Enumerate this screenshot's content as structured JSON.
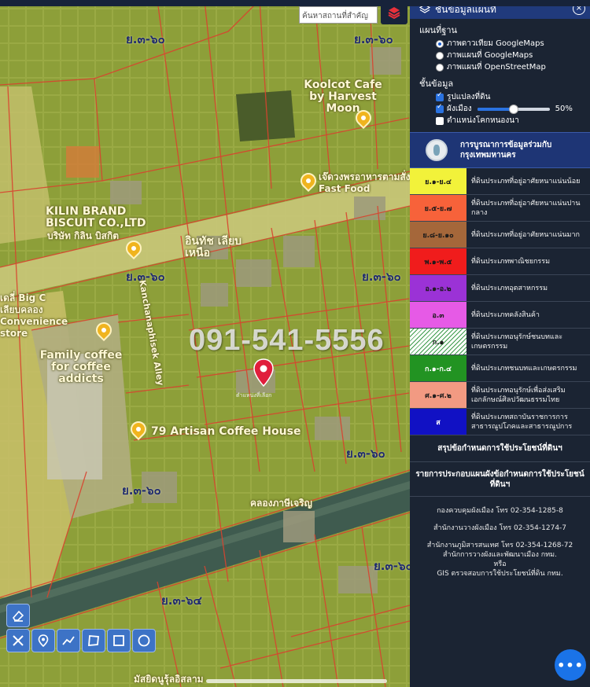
{
  "map": {
    "search_placeholder": "ค้นหาสถานที่สำคัญ",
    "phone_watermark": "091-541-5556",
    "zone_labels": [
      {
        "text": "ย.๓-๖๐"
      },
      {
        "text": "ย.๓-๖๐"
      },
      {
        "text": "ย.๓-๖๐"
      },
      {
        "text": "ย.๓-๖๐"
      },
      {
        "text": "ย.๓-๖๐"
      },
      {
        "text": "ย.๓-๖๐"
      },
      {
        "text": "ย.๓-๖๐"
      },
      {
        "text": "ย.๓-๖๔"
      },
      {
        "text": "ย.๓-๖๐"
      }
    ],
    "pois": [
      {
        "text": "Koolcot Cafe by Harvest Moon"
      },
      {
        "text": "เจ๊ดวงพรอาหารตามสั่ง Fast Food"
      },
      {
        "text": "KILIN BRAND BISCUIT CO.,LTD"
      },
      {
        "text": "บริษัท กิลิน บิสกิต"
      },
      {
        "text": "อินทัช เลียบเหนือ"
      },
      {
        "text": "Kanchanaphisek Alley"
      },
      {
        "text": "Family coffee for coffee addicts"
      },
      {
        "text": "79 Artisan Coffee House"
      },
      {
        "text": "เดลี่ Big C เลียบคลอง Convenience store"
      },
      {
        "text": "คลองภาษีเจริญ"
      },
      {
        "text": "มัสยิดนูรุ้ลอิสลาม"
      }
    ],
    "marker_label": "ตำแหน่งที่เลือก",
    "tools": [
      "eraser-icon",
      "clear-icon",
      "pin-icon",
      "polyline-icon",
      "polygon-icon",
      "rectangle-icon",
      "circle-icon"
    ]
  },
  "panel": {
    "header": "ชั้นข้อมูลแผนที่",
    "close": "×",
    "basemap_title": "แผนที่ฐาน",
    "basemaps": [
      {
        "label": "ภาพดาวเทียม GoogleMaps",
        "selected": true
      },
      {
        "label": "ภาพแผนที่ GoogleMaps",
        "selected": false
      },
      {
        "label": "ภาพแผนที่ OpenStreetMap",
        "selected": false
      }
    ],
    "layers_title": "ชั้นข้อมูล",
    "layers": [
      {
        "label": "รูปแปลงที่ดิน",
        "checked": true
      },
      {
        "label": "ผังเมือง",
        "checked": true,
        "opacity": 50,
        "opacity_label": "50%"
      },
      {
        "label": "ตำแหน่งโคกหนองนา",
        "checked": false
      }
    ],
    "bma_text": "การบูรณาการข้อมูลร่วมกับ กรุงเทพมหานคร",
    "legend": [
      {
        "code": "ย.๑-ย.๔",
        "desc": "ที่ดินประเภทที่อยู่อาศัยหนาแน่นน้อย",
        "color": "#f2f23a"
      },
      {
        "code": "ย.๕-ย.๗",
        "desc": "ที่ดินประเภทที่อยู่อาศัยหนาแน่นปานกลาง",
        "color": "#f7623a"
      },
      {
        "code": "ย.๘-ย.๑๐",
        "desc": "ที่ดินประเภทที่อยู่อาศัยหนาแน่นมาก",
        "color": "#a5673a"
      },
      {
        "code": "พ.๑-พ.๕",
        "desc": "ที่ดินประเภทพาณิชยกรรม",
        "color": "#f01c1c"
      },
      {
        "code": "อ.๑-อ.๒",
        "desc": "ที่ดินประเภทอุตสาหกรรม",
        "color": "#9b32d6"
      },
      {
        "code": "อ.๓",
        "desc": "ที่ดินประเภทคลังสินค้า",
        "color": "#e65ae6"
      },
      {
        "code": "ก.๑",
        "desc": "ที่ดินประเภทอนุรักษ์ชนบทและเกษตรกรรม",
        "color": "#ffffff",
        "hatched": true
      },
      {
        "code": "ก.๑-ก.๔",
        "desc": "ที่ดินประเภทชนบทและเกษตรกรรม",
        "color": "#229322"
      },
      {
        "code": "ศ.๑-ศ.๒",
        "desc": "ที่ดินประเภทอนุรักษ์เพื่อส่งเสริมเอกลักษณ์ศิลปวัฒนธรรมไทย",
        "color": "#f29a82"
      },
      {
        "code": "ส",
        "desc": "ที่ดินประเภทสถาบันราชการการสาธารณูปโภคและสาธารณูปการ",
        "color": "#1111c4"
      }
    ],
    "summary_link": "สรุปข้อกำหนดการใช้ประโยชน์ที่ดินฯ",
    "details_link": "รายการประกอบแผนผังข้อกำหนดการใช้ประโยชน์ที่ดินฯ",
    "contacts": [
      "กองควบคุมผังเมือง โทร 02-354-1285-8",
      "สำนักงานวางผังเมือง โทร 02-354-1274-7",
      "สำนักงานภูมิสารสนเทศ โทร 02-354-1268-72",
      "สำนักการวางผังและพัฒนาเมือง กทม.",
      "หรือ",
      "GIS ตรวจสอบการใช้ประโยชน์ที่ดิน กทม."
    ],
    "fab": "•••"
  }
}
